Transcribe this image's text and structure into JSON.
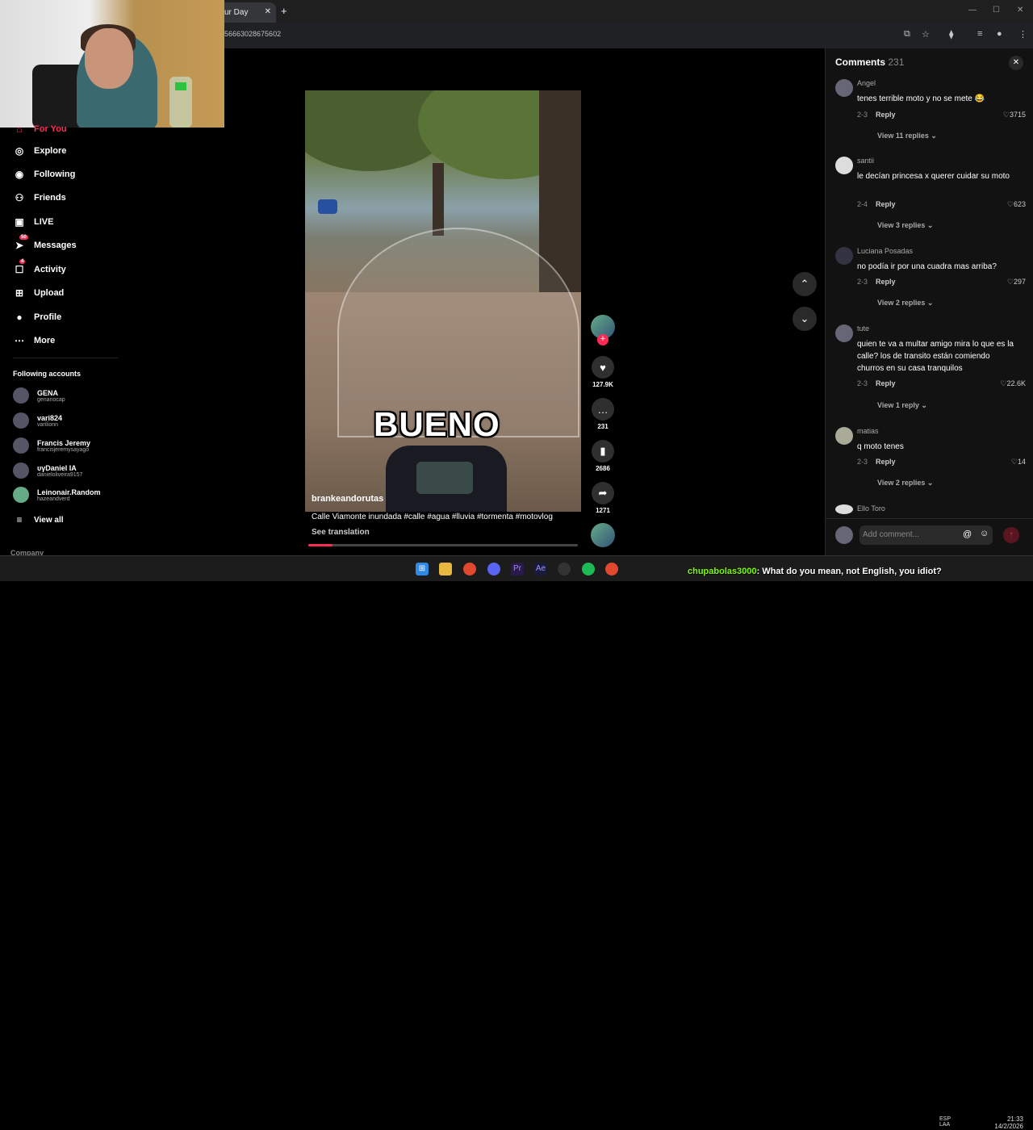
{
  "browser": {
    "tab_title": "ur Day",
    "tab_close": "✕",
    "new_tab": "+",
    "url": "56663028675602"
  },
  "sidebar": {
    "items": [
      {
        "label": "For You",
        "icon": "home-icon"
      },
      {
        "label": "Explore",
        "icon": "compass-icon"
      },
      {
        "label": "Following",
        "icon": "following-avatar-icon"
      },
      {
        "label": "Friends",
        "icon": "friends-icon"
      },
      {
        "label": "LIVE",
        "icon": "live-icon"
      },
      {
        "label": "Messages",
        "icon": "messages-icon",
        "badge": "50"
      },
      {
        "label": "Activity",
        "icon": "activity-icon",
        "badge": "4"
      },
      {
        "label": "Upload",
        "icon": "upload-icon"
      },
      {
        "label": "Profile",
        "icon": "profile-avatar-icon"
      },
      {
        "label": "More",
        "icon": "more-icon"
      }
    ],
    "following_title": "Following accounts",
    "accounts": [
      {
        "name": "GENA",
        "handle": "genanocap"
      },
      {
        "name": "vari824",
        "handle": "varilionn"
      },
      {
        "name": "Francis Jeremy",
        "handle": "francisjeremysayago"
      },
      {
        "name": "υγDaniel IA",
        "handle": "danieloliveira9157"
      },
      {
        "name": "Leinonair.Random",
        "handle": "hazeandverd"
      }
    ],
    "view_all": "View all",
    "company": "Company"
  },
  "video": {
    "overlay_text": "BUENO",
    "author": "brankeandorutas",
    "caption": "Calle Viamonte inundada #calle #agua #lluvia #tormenta #motovlog",
    "see_translation": "See translation",
    "progress_fraction": 0.09
  },
  "actions": {
    "likes": "127.9K",
    "comments": "231",
    "saves": "2686",
    "shares": "1271"
  },
  "comments_panel": {
    "title": "Comments",
    "count": "231",
    "reply_label": "Reply",
    "comments": [
      {
        "user": "Angel",
        "text": "tenes terrible moto y no se mete 😂",
        "date": "2-3",
        "likes": "3715",
        "replies": "View 11 replies"
      },
      {
        "user": "santii",
        "text": "le decían princesa x querer cuidar su moto",
        "date": "2-4",
        "likes": "623",
        "replies": "View 3 replies"
      },
      {
        "user": "Luciana Posadas",
        "text": "no podía ir por una cuadra mas arriba?",
        "date": "2-3",
        "likes": "297",
        "replies": "View 2 replies"
      },
      {
        "user": "tute",
        "text": "quien te va a multar amigo mira lo que es la calle? los de transito están comiendo churros en su casa tranquilos",
        "date": "2-3",
        "likes": "22.6K",
        "replies": "View 1 reply"
      },
      {
        "user": "matias",
        "text": "q moto tenes",
        "date": "2-3",
        "likes": "14",
        "replies": "View 2 replies"
      },
      {
        "user": "Ello Toro",
        "text": "",
        "date": "",
        "likes": "",
        "replies": ""
      }
    ],
    "add_placeholder": "Add comment..."
  },
  "stream_chat": {
    "user": "chupabolas3000",
    "message": ": What do you mean, not English, you idiot?"
  },
  "system": {
    "time": "21:33",
    "date": "14/2/2026",
    "lang1": "ESP",
    "lang2": "LAA"
  }
}
